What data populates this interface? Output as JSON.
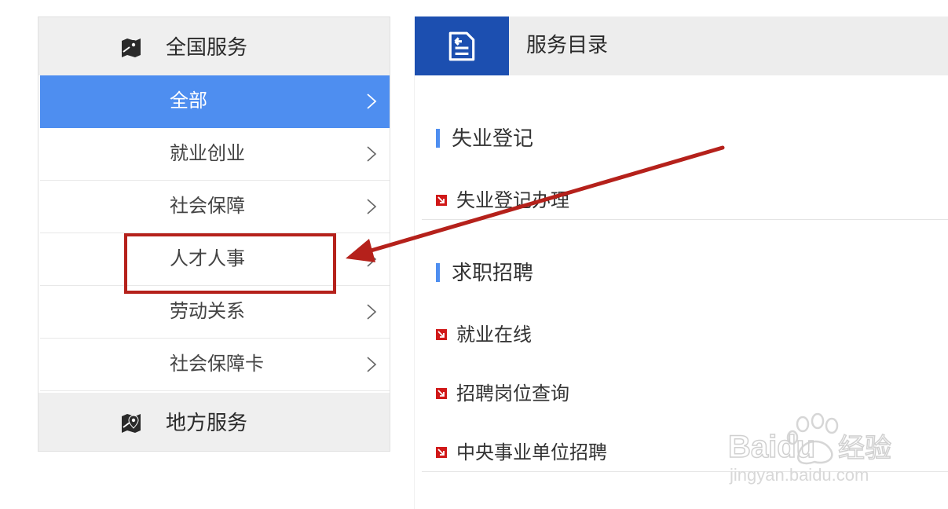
{
  "sidebar": {
    "national_title": "全国服务",
    "local_title": "地方服务",
    "items": [
      {
        "label": "全部",
        "active": true
      },
      {
        "label": "就业创业",
        "active": false
      },
      {
        "label": "社会保障",
        "active": false
      },
      {
        "label": "人才人事",
        "active": false
      },
      {
        "label": "劳动关系",
        "active": false
      },
      {
        "label": "社会保障卡",
        "active": false
      }
    ]
  },
  "panel": {
    "title": "服务目录",
    "sections": [
      {
        "title": "失业登记",
        "links": [
          "失业登记办理"
        ]
      },
      {
        "title": "求职招聘",
        "links": [
          "就业在线",
          "招聘岗位查询",
          "中央事业单位招聘"
        ]
      }
    ]
  },
  "watermark": {
    "brand": "Baidu",
    "brand_cn": "经验",
    "url": "jingyan.baidu.com"
  },
  "colors": {
    "active_item": "#4e8ef0",
    "header_icon_bg": "#1c4fb0",
    "annotation_red": "#b5211b",
    "section_bar": "#4e8ef0"
  }
}
